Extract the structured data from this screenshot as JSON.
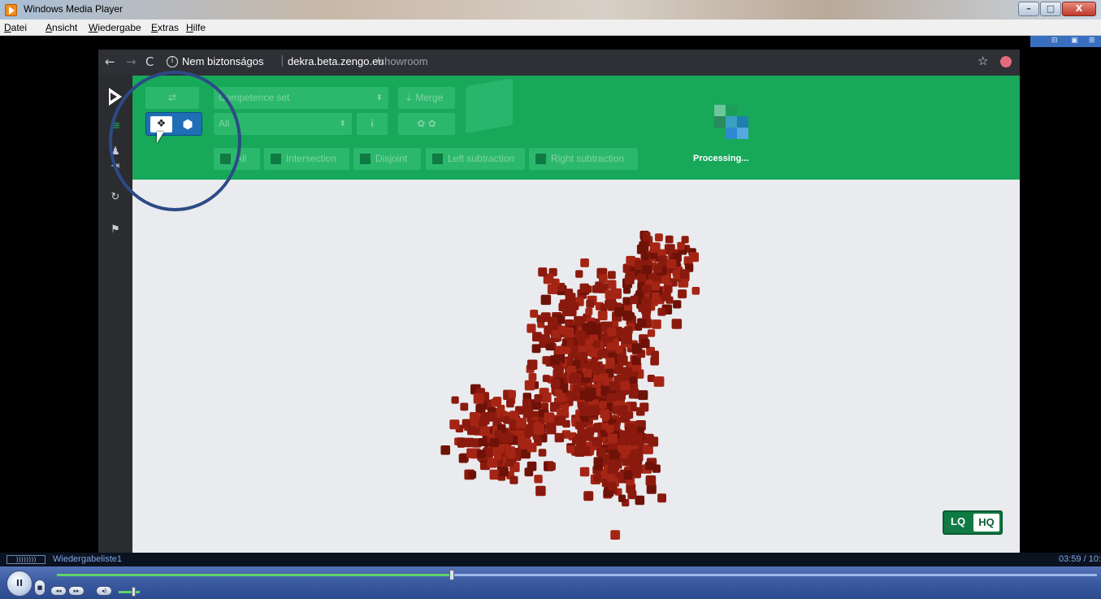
{
  "window": {
    "title": "Windows Media Player",
    "buttons": {
      "minimize": "–",
      "maximize": "□",
      "close": "X"
    }
  },
  "menu": [
    "Datei",
    "Ansicht",
    "Wiedergabe",
    "Extras",
    "Hilfe"
  ],
  "browser": {
    "back": "←",
    "forward": "→",
    "reload": "C",
    "security_label": "Nem biztonságos",
    "url_host": "dekra.beta.zengo.eu",
    "url_path": "/showroom",
    "star": "☆"
  },
  "app": {
    "sidebar": {
      "menu_icon": "≡",
      "user_icon": "♟",
      "logout_icon": "⇥",
      "sync_icon": "↻",
      "flag_icon": "⚑"
    },
    "toolbar": {
      "sync_button": "⇄",
      "competence_select": "Competence set",
      "all_select": "All",
      "info_button": "i",
      "merge_button": "Merge",
      "toggle_layers": "❖",
      "toggle_cube": "⬢",
      "ops": [
        "All",
        "Intersection",
        "Disjoint",
        "Left subtraction",
        "Right subtraction"
      ]
    },
    "processing_text": "Processing...",
    "quality": {
      "lq": "LQ",
      "hq": "HQ"
    }
  },
  "player": {
    "playlist_icon": "))))))))",
    "playlist_name": "Wiedergabeliste1",
    "time": "03:59 / 10:",
    "progress": 0.38,
    "volume": 0.65,
    "play_pause": "II",
    "stop": "■",
    "prev": "◂◂",
    "next": "▸▸",
    "mute": "◂)"
  },
  "colors": {
    "green": "#17a85a",
    "cube_red": "#8b1a0e",
    "highlight_circle": "#2d4a86",
    "sidebar": "#2a2c30"
  }
}
